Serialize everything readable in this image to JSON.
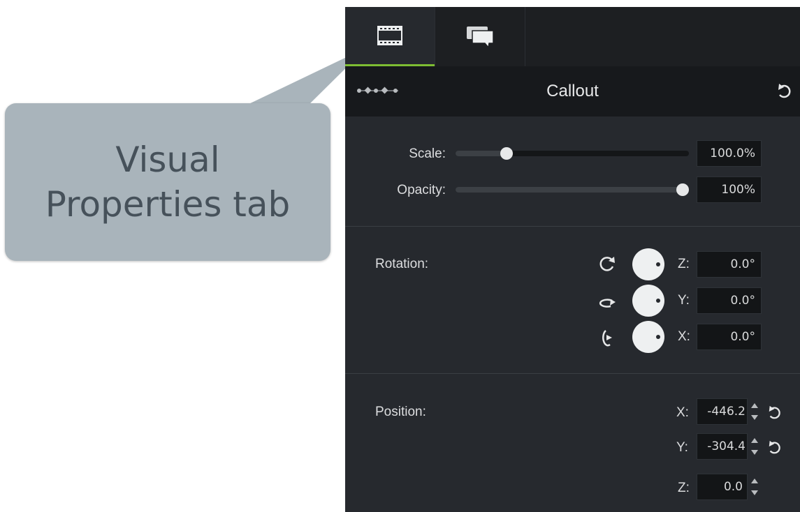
{
  "callout": {
    "line1": "Visual",
    "line2": "Properties tab"
  },
  "tabs": [
    {
      "icon": "film-strip-icon",
      "active": true
    },
    {
      "icon": "speech-bubble-icon",
      "active": false
    }
  ],
  "header": {
    "title": "Callout",
    "left_icon": "keyframes-icon",
    "right_icon": "reset-icon"
  },
  "scale": {
    "label": "Scale:",
    "value": "100.0%",
    "level": 0.2
  },
  "opacity": {
    "label": "Opacity:",
    "value": "100%",
    "level": 1.0
  },
  "rotation": {
    "label": "Rotation:",
    "z": {
      "label": "Z:",
      "value": "0.0°"
    },
    "y": {
      "label": "Y:",
      "value": "0.0°"
    },
    "x": {
      "label": "X:",
      "value": "0.0°"
    }
  },
  "position": {
    "label": "Position:",
    "x": {
      "label": "X:",
      "value": "-446.2"
    },
    "y": {
      "label": "Y:",
      "value": "-304.4"
    },
    "z": {
      "label": "Z:",
      "value": "0.0"
    }
  },
  "colors": {
    "accent": "#7ebd33",
    "panel_bg": "#26292e",
    "callout_bg": "#a9b4bb"
  }
}
